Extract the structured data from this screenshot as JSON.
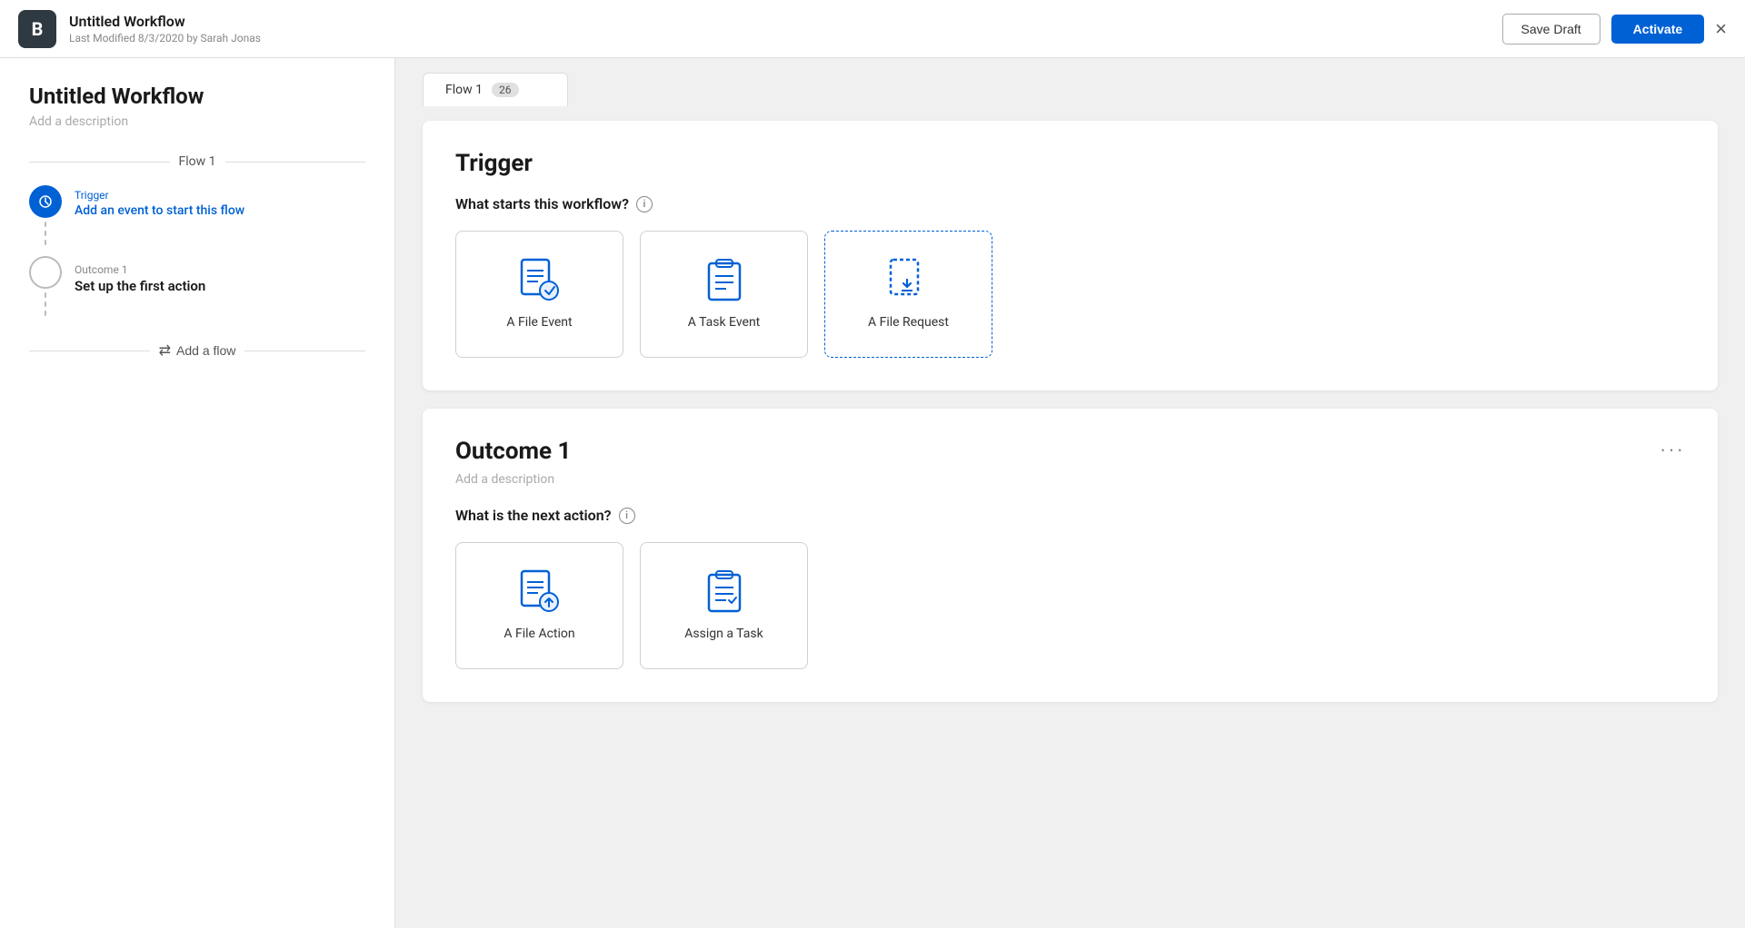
{
  "header": {
    "app_icon": "B",
    "workflow_title": "Untitled Workflow",
    "last_modified": "Last Modified 8/3/2020 by Sarah Jonas",
    "save_draft_label": "Save Draft",
    "activate_label": "Activate",
    "close_label": "×"
  },
  "sidebar": {
    "workflow_title": "Untitled Workflow",
    "add_description": "Add a description",
    "flow_name": "Flow 1",
    "trigger_label": "Trigger",
    "trigger_action": "Add an event to start this flow",
    "outcome_label": "Outcome 1",
    "outcome_action": "Set up the first action",
    "add_flow_label": "Add a flow"
  },
  "tab": {
    "flow_name": "Flow 1",
    "badge": "26"
  },
  "trigger_card": {
    "title": "Trigger",
    "question": "What starts this workflow?",
    "options": [
      {
        "label": "A File Event"
      },
      {
        "label": "A Task Event"
      },
      {
        "label": "A File Request"
      }
    ]
  },
  "outcome_card": {
    "title": "Outcome 1",
    "add_description": "Add a description",
    "question": "What is the next action?",
    "options": [
      {
        "label": "A File Action"
      },
      {
        "label": "Assign a Task"
      }
    ]
  }
}
